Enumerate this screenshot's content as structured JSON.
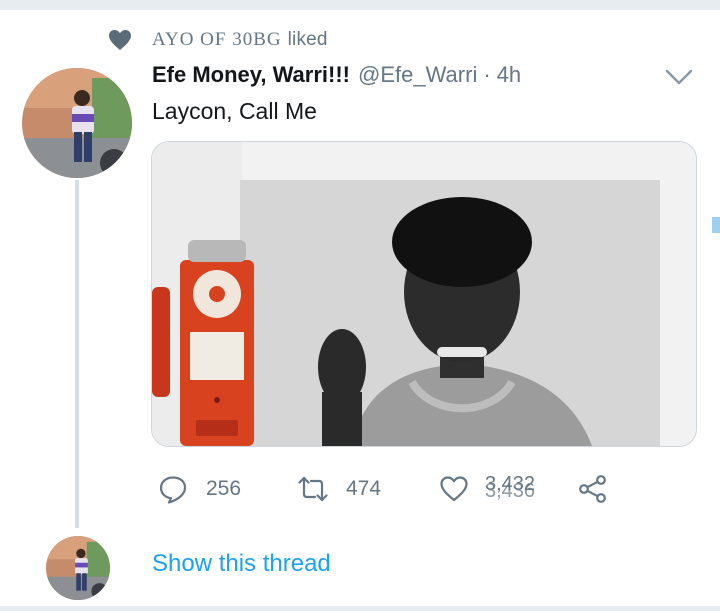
{
  "context": {
    "liker": "AYO OF 30BG",
    "suffix": "liked"
  },
  "tweet": {
    "display_name": "Efe Money, Warri!!!",
    "handle": "@Efe_Warri",
    "separator": "·",
    "time": "4h",
    "text": "Laycon, Call Me"
  },
  "actions": {
    "reply_count": "256",
    "retweet_count": "474",
    "like_count_old": "3,432",
    "like_count_new": "3,436"
  },
  "thread": {
    "show_label": "Show this thread"
  },
  "icons": {
    "liked": "heart-filled-icon",
    "more": "chevron-down-icon",
    "reply": "reply-icon",
    "retweet": "retweet-icon",
    "like": "heart-icon",
    "share": "share-icon"
  },
  "colors": {
    "accent": "#1da1f2",
    "muted": "#657786",
    "text": "#14171a",
    "border": "#ccd6dd"
  }
}
